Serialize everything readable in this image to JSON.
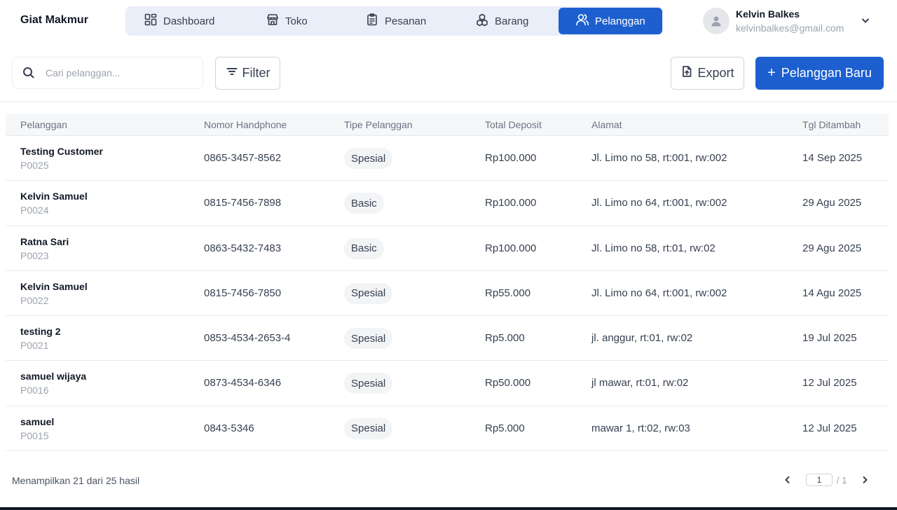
{
  "brand": "Giat Makmur",
  "nav": [
    {
      "label": "Dashboard",
      "icon": "dashboard-icon",
      "active": false
    },
    {
      "label": "Toko",
      "icon": "store-icon",
      "active": false
    },
    {
      "label": "Pesanan",
      "icon": "clipboard-icon",
      "active": false
    },
    {
      "label": "Barang",
      "icon": "boxes-icon",
      "active": false
    },
    {
      "label": "Pelanggan",
      "icon": "users-icon",
      "active": true
    }
  ],
  "user": {
    "name": "Kelvin Balkes",
    "email": "kelvinbalkes@gmail.com"
  },
  "toolbar": {
    "search_placeholder": "Cari pelanggan...",
    "filter_label": "Filter",
    "export_label": "Export",
    "new_label": "Pelanggan Baru"
  },
  "table": {
    "columns": [
      "Pelanggan",
      "Nomor Handphone",
      "Tipe Pelanggan",
      "Total Deposit",
      "Alamat",
      "Tgl Ditambah"
    ],
    "rows": [
      {
        "name": "Testing Customer",
        "id": "P0025",
        "phone": "0865-3457-8562",
        "type": "Spesial",
        "deposit": "Rp100.000",
        "address": "Jl. Limo no 58, rt:001, rw:002",
        "date": "14 Sep 2025"
      },
      {
        "name": "Kelvin Samuel",
        "id": "P0024",
        "phone": "0815-7456-7898",
        "type": "Basic",
        "deposit": "Rp100.000",
        "address": "Jl. Limo no 64, rt:001, rw:002",
        "date": "29 Agu 2025"
      },
      {
        "name": "Ratna Sari",
        "id": "P0023",
        "phone": "0863-5432-7483",
        "type": "Basic",
        "deposit": "Rp100.000",
        "address": "Jl. Limo no 58, rt:01, rw:02",
        "date": "29 Agu 2025"
      },
      {
        "name": "Kelvin Samuel",
        "id": "P0022",
        "phone": "0815-7456-7850",
        "type": "Spesial",
        "deposit": "Rp55.000",
        "address": "Jl. Limo no 64, rt:001, rw:002",
        "date": "14 Agu 2025"
      },
      {
        "name": "testing 2",
        "id": "P0021",
        "phone": "0853-4534-2653-4",
        "type": "Spesial",
        "deposit": "Rp5.000",
        "address": "jl. anggur, rt:01, rw:02",
        "date": "19 Jul 2025"
      },
      {
        "name": "samuel wijaya",
        "id": "P0016",
        "phone": "0873-4534-6346",
        "type": "Spesial",
        "deposit": "Rp50.000",
        "address": "jl mawar, rt:01, rw:02",
        "date": "12 Jul 2025"
      },
      {
        "name": "samuel",
        "id": "P0015",
        "phone": "0843-5346",
        "type": "Spesial",
        "deposit": "Rp5.000",
        "address": "mawar 1, rt:02, rw:03",
        "date": "12 Jul 2025"
      }
    ]
  },
  "footer": {
    "summary": "Menampilkan 21 dari 25 hasil",
    "page": "1",
    "total_pages": "/ 1"
  },
  "colors": {
    "accent": "#1d5fcf",
    "nav_bg": "#e9eef8"
  }
}
